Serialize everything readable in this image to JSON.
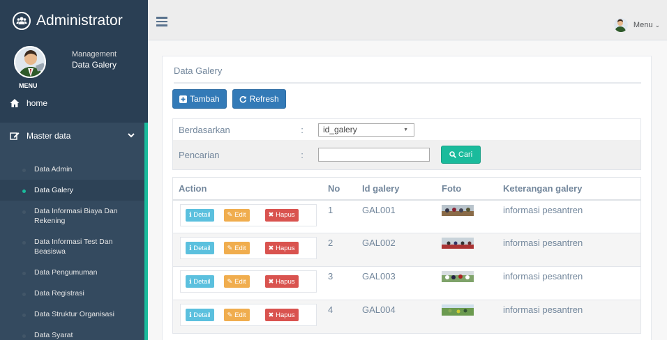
{
  "sidebar": {
    "brand": "Administrator",
    "profile": {
      "line1": "Management",
      "line2": "Data Galery",
      "menu_caption": "MENU"
    },
    "home": "home",
    "master": "Master data",
    "items": [
      "Data Admin",
      "Data Galery",
      "Data Informasi Biaya Dan Rekening",
      "Data Informasi Test Dan Beasiswa",
      "Data Pengumuman",
      "Data Registrasi",
      "Data Struktur Organisasi",
      "Data Syarat"
    ]
  },
  "topnav": {
    "user_menu": "Menu"
  },
  "panel": {
    "title": "Data Galery",
    "tambah": "Tambah",
    "refresh": "Refresh",
    "filter": {
      "label1": "Berdasarkan",
      "label2": "Pencarian",
      "colon": ":",
      "select_value": "id_galery",
      "search_value": "",
      "cari": "Cari"
    }
  },
  "table": {
    "headers": [
      "Action",
      "No",
      "Id galery",
      "Foto",
      "Keterangan galery"
    ],
    "actions": {
      "detail": "Detail",
      "edit": "Edit",
      "hapus": "Hapus"
    },
    "rows": [
      {
        "no": "1",
        "id": "GAL001",
        "ket": "informasi pesantren"
      },
      {
        "no": "2",
        "id": "GAL002",
        "ket": "informasi pesantren"
      },
      {
        "no": "3",
        "id": "GAL003",
        "ket": "informasi pesantren"
      },
      {
        "no": "4",
        "id": "GAL004",
        "ket": "informasi pesantren"
      }
    ]
  },
  "colors": {
    "sidebar": "#2a3f54",
    "accent": "#1abb9c",
    "primary": "#337ab7",
    "info": "#5bc0de",
    "warning": "#f0ad4e",
    "danger": "#d9534f"
  }
}
